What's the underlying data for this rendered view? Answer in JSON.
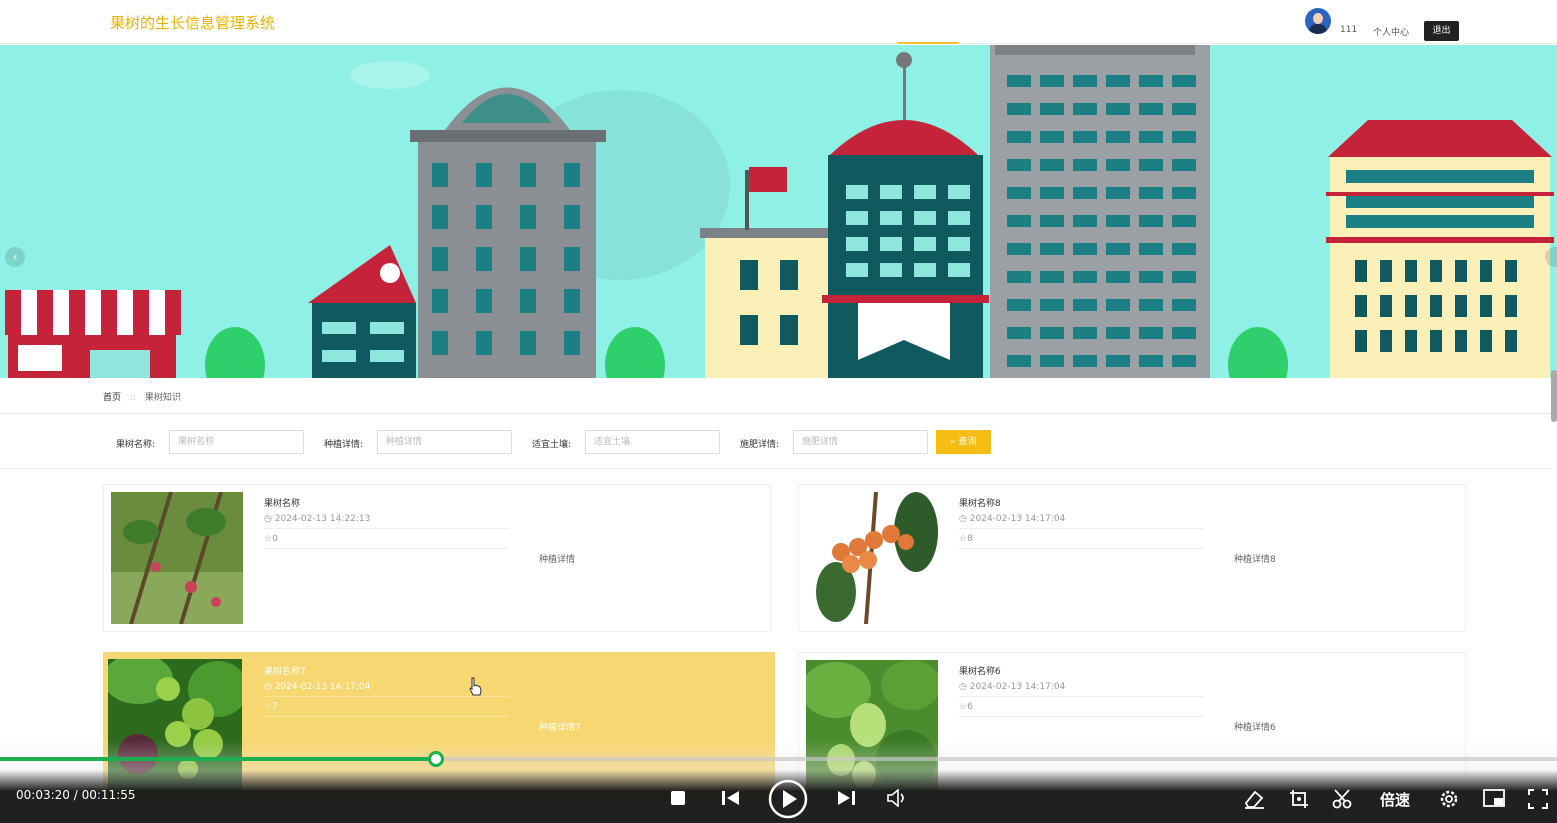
{
  "header": {
    "site_title": "果树的生长信息管理系统",
    "username": "111",
    "center_label": "个人中心",
    "logout_label": "退出"
  },
  "breadcrumb": {
    "home": "首页",
    "separator": "::",
    "current": "果树知识"
  },
  "search": {
    "fields": [
      {
        "label": "果树名称:",
        "placeholder": "果树名称"
      },
      {
        "label": "种植详情:",
        "placeholder": "种植详情"
      },
      {
        "label": "适宜土壤:",
        "placeholder": "适宜土壤"
      },
      {
        "label": "施肥详情:",
        "placeholder": "施肥详情"
      }
    ],
    "button_label": "查询"
  },
  "cards": [
    {
      "name": "果树名称",
      "time": "2024-02-13 14:22:13",
      "count": "0",
      "detail": "种植详情"
    },
    {
      "name": "果树名称8",
      "time": "2024-02-13 14:17:04",
      "count": "8",
      "detail": "种植详情8"
    },
    {
      "name": "果树名称7",
      "time": "2024-02-13 14:17:04",
      "count": "7",
      "detail": "种植详情7"
    },
    {
      "name": "果树名称6",
      "time": "2024-02-13 14:17:04",
      "count": "6",
      "detail": "种植详情6"
    }
  ],
  "player": {
    "time": "00:03:20 / 00:11:55",
    "progress_fraction": 0.28,
    "speed_label": "倍速",
    "accent_color": "#1aaf4f"
  },
  "colors": {
    "brand": "#e8b300",
    "search_button": "#f5be14",
    "card_hover": "#f7d772",
    "banner_sky": "#8ff0e6"
  }
}
